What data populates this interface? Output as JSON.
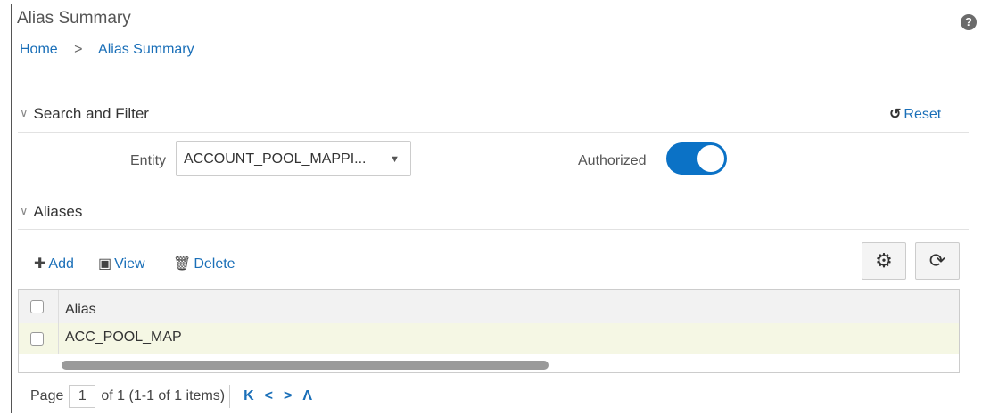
{
  "page": {
    "title": "Alias Summary",
    "help_icon": "?"
  },
  "breadcrumb": {
    "home": "Home",
    "separator": ">",
    "current": "Alias Summary"
  },
  "search_filter": {
    "heading": "Search and Filter",
    "reset_label": "Reset",
    "entity_label": "Entity",
    "entity_value": "ACCOUNT_POOL_MAPPI...",
    "authorized_label": "Authorized",
    "authorized_on": true
  },
  "aliases": {
    "heading": "Aliases",
    "toolbar": {
      "add": "Add",
      "view": "View",
      "delete": "Delete"
    },
    "table": {
      "columns": [
        "Alias"
      ],
      "rows": [
        {
          "alias": "ACC_POOL_MAP"
        }
      ]
    }
  },
  "pagination": {
    "page_label": "Page",
    "current_page": "1",
    "summary": "of 1 (1-1 of 1 items)",
    "first": "K",
    "prev": "<",
    "next": ">",
    "last": "Ʌ"
  },
  "colors": {
    "accent": "#0b72c6",
    "link": "#1a6fb8",
    "row_highlight": "#f5f7e4"
  }
}
